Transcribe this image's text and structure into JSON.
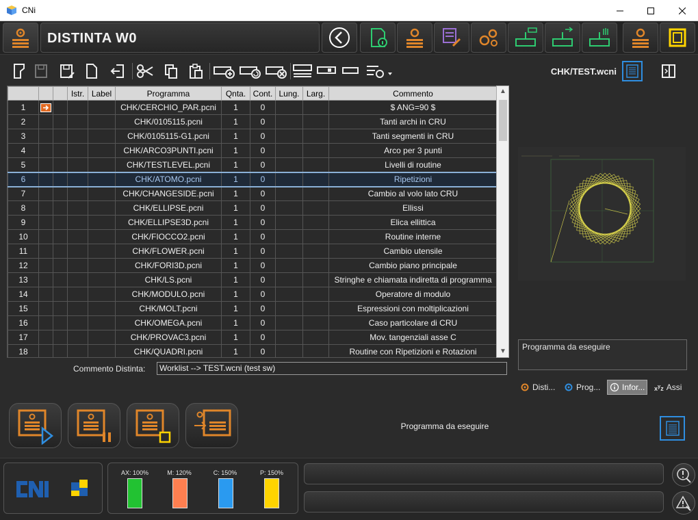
{
  "window": {
    "title": "CNi"
  },
  "header": {
    "title": "DISTINTA W0"
  },
  "toolbar": {
    "filename": "CHK/TEST.wcni"
  },
  "table": {
    "headers": [
      "",
      "",
      "",
      "Istr.",
      "Label",
      "Programma",
      "Qnta.",
      "Cont.",
      "Lung.",
      "Larg.",
      "Commento"
    ],
    "selected_row": 6,
    "rows": [
      {
        "n": "1",
        "flag": true,
        "prog": "CHK/CERCHIO_PAR.pcni",
        "qnta": "1",
        "cont": "0",
        "comm": "$  ANG=90 $"
      },
      {
        "n": "2",
        "flag": false,
        "prog": "CHK/0105115.pcni",
        "qnta": "1",
        "cont": "0",
        "comm": "Tanti archi in CRU"
      },
      {
        "n": "3",
        "flag": false,
        "prog": "CHK/0105115-G1.pcni",
        "qnta": "1",
        "cont": "0",
        "comm": "Tanti segmenti in CRU"
      },
      {
        "n": "4",
        "flag": false,
        "prog": "CHK/ARCO3PUNTI.pcni",
        "qnta": "1",
        "cont": "0",
        "comm": "Arco per 3 punti"
      },
      {
        "n": "5",
        "flag": false,
        "prog": "CHK/TESTLEVEL.pcni",
        "qnta": "1",
        "cont": "0",
        "comm": "Livelli di routine"
      },
      {
        "n": "6",
        "flag": false,
        "prog": "CHK/ATOMO.pcni",
        "qnta": "1",
        "cont": "0",
        "comm": "Ripetizioni"
      },
      {
        "n": "7",
        "flag": false,
        "prog": "CHK/CHANGESIDE.pcni",
        "qnta": "1",
        "cont": "0",
        "comm": "Cambio al volo lato CRU"
      },
      {
        "n": "8",
        "flag": false,
        "prog": "CHK/ELLIPSE.pcni",
        "qnta": "1",
        "cont": "0",
        "comm": "Ellissi"
      },
      {
        "n": "9",
        "flag": false,
        "prog": "CHK/ELLIPSE3D.pcni",
        "qnta": "1",
        "cont": "0",
        "comm": "Elica ellittica"
      },
      {
        "n": "10",
        "flag": false,
        "prog": "CHK/FIOCCO2.pcni",
        "qnta": "1",
        "cont": "0",
        "comm": "Routine interne"
      },
      {
        "n": "11",
        "flag": false,
        "prog": "CHK/FLOWER.pcni",
        "qnta": "1",
        "cont": "0",
        "comm": "Cambio utensile"
      },
      {
        "n": "12",
        "flag": false,
        "prog": "CHK/FORI3D.pcni",
        "qnta": "1",
        "cont": "0",
        "comm": "Cambio piano principale"
      },
      {
        "n": "13",
        "flag": false,
        "prog": "CHK/LS.pcni",
        "qnta": "1",
        "cont": "0",
        "comm": "Stringhe e chiamata indiretta di programma"
      },
      {
        "n": "14",
        "flag": false,
        "prog": "CHK/MODULO.pcni",
        "qnta": "1",
        "cont": "0",
        "comm": "Operatore di modulo"
      },
      {
        "n": "15",
        "flag": false,
        "prog": "CHK/MOLT.pcni",
        "qnta": "1",
        "cont": "0",
        "comm": "Espressioni con moltiplicazioni"
      },
      {
        "n": "16",
        "flag": false,
        "prog": "CHK/OMEGA.pcni",
        "qnta": "1",
        "cont": "0",
        "comm": "Caso particolare di CRU"
      },
      {
        "n": "17",
        "flag": false,
        "prog": "CHK/PROVAC3.pcni",
        "qnta": "1",
        "cont": "0",
        "comm": "Mov. tangenziali asse C"
      },
      {
        "n": "18",
        "flag": false,
        "prog": "CHK/QUADRI.pcni",
        "qnta": "1",
        "cont": "0",
        "comm": "Routine con Ripetizioni e Rotazioni"
      }
    ]
  },
  "commento_distinta": {
    "label": "Commento Distinta:",
    "value": "Worklist --> TEST.wcni (test sw)"
  },
  "right_panel": {
    "info_text": "Programma da eseguire",
    "tabs": [
      {
        "label": "Disti...",
        "icon": "gear-icon"
      },
      {
        "label": "Prog...",
        "icon": "gear-icon"
      },
      {
        "label": "Infor...",
        "icon": "info-icon",
        "active": true
      },
      {
        "label": "Assi",
        "icon": "xyz-icon"
      }
    ]
  },
  "status_text": "Programma da eseguire",
  "overrides": [
    {
      "label": "AX: 100%",
      "level": 1.0,
      "color": "#22c232"
    },
    {
      "label": "M: 120%",
      "level": 1.0,
      "color": "#ff7f50"
    },
    {
      "label": "C: 150%",
      "level": 1.0,
      "color": "#2a9af0"
    },
    {
      "label": "P: 150%",
      "level": 1.0,
      "color": "#ffd400"
    }
  ],
  "colors": {
    "accent_orange": "#e0862a",
    "accent_green": "#2ecc71",
    "accent_yellow": "#ffd400",
    "accent_blue": "#2f8ee0"
  }
}
